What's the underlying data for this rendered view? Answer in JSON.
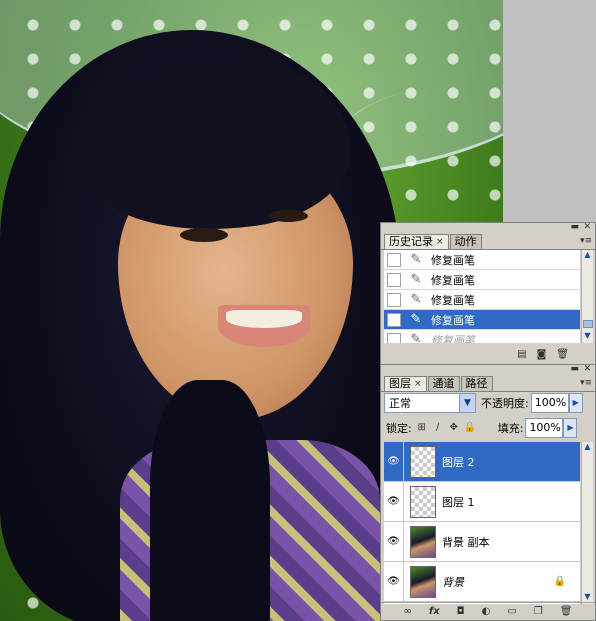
{
  "history": {
    "tabs": [
      {
        "label": "历史记录",
        "close": "×"
      },
      {
        "label": "动作"
      }
    ],
    "window_close": "✕",
    "window_min": "▬",
    "menu": "▾≡",
    "rows": [
      {
        "label": "修复画笔"
      },
      {
        "label": "修复画笔"
      },
      {
        "label": "修复画笔"
      },
      {
        "label": "修复画笔"
      },
      {
        "label": "修复画笔"
      }
    ],
    "selected_index": 3,
    "scroll_up": "▲",
    "scroll_down": "▼",
    "footer_icons": [
      "new-document-from-state-icon",
      "camera-icon",
      "trash-icon"
    ],
    "footer_glyphs": [
      "▤",
      "◙",
      "🗑"
    ]
  },
  "layers": {
    "tabs": [
      {
        "label": "图层",
        "close": "×"
      },
      {
        "label": "通道"
      },
      {
        "label": "路径"
      }
    ],
    "blend_mode": "正常",
    "opacity_label": "不透明度:",
    "opacity_value": "100%",
    "lock_label": "锁定:",
    "fill_label": "填充:",
    "fill_value": "100%",
    "layers": [
      {
        "name": "图层 2",
        "selected": true,
        "type": "transparent"
      },
      {
        "name": "图层 1",
        "selected": false,
        "type": "transparent"
      },
      {
        "name": "背景 副本",
        "selected": false,
        "type": "photo"
      },
      {
        "name": "背景",
        "selected": false,
        "type": "photo",
        "locked": true
      }
    ],
    "lock_glyphs": [
      "⊞",
      "∕",
      "✥",
      "🔒"
    ],
    "footer_glyphs": [
      "∞",
      "fx",
      "◘",
      "◐",
      "▭",
      "❐",
      "🗑"
    ],
    "footer_icons": [
      "link-icon",
      "fx-icon",
      "mask-icon",
      "adjustment-icon",
      "folder-icon",
      "new-layer-icon",
      "trash-icon"
    ]
  }
}
